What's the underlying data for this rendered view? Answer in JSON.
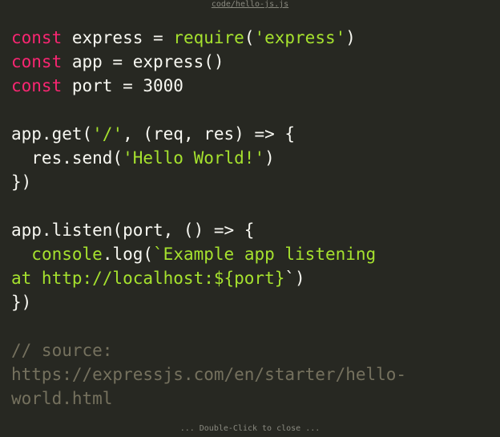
{
  "header": {
    "file_path": "code/hello-js.js"
  },
  "code": {
    "lines": [
      [
        {
          "t": "const",
          "c": "kw"
        },
        {
          "t": " express = ",
          "c": "plain"
        },
        {
          "t": "require",
          "c": "fn"
        },
        {
          "t": "(",
          "c": "plain"
        },
        {
          "t": "'express'",
          "c": "str"
        },
        {
          "t": ")",
          "c": "plain"
        }
      ],
      [
        {
          "t": "const",
          "c": "kw"
        },
        {
          "t": " app = express()",
          "c": "plain"
        }
      ],
      [
        {
          "t": "const",
          "c": "kw"
        },
        {
          "t": " port = 3000",
          "c": "plain"
        }
      ],
      [],
      [
        {
          "t": "app.get(",
          "c": "plain"
        },
        {
          "t": "'/'",
          "c": "str"
        },
        {
          "t": ", (req, res) => {",
          "c": "plain"
        }
      ],
      [
        {
          "t": "  res.send(",
          "c": "plain"
        },
        {
          "t": "'Hello World!'",
          "c": "str"
        },
        {
          "t": ")",
          "c": "plain"
        }
      ],
      [
        {
          "t": "})",
          "c": "plain"
        }
      ],
      [],
      [
        {
          "t": "app.listen(port, () => {",
          "c": "plain"
        }
      ],
      [
        {
          "t": "  ",
          "c": "plain"
        },
        {
          "t": "console",
          "c": "fn"
        },
        {
          "t": ".log(",
          "c": "plain"
        },
        {
          "t": "`Example app listening",
          "c": "str"
        }
      ],
      [
        {
          "t": "at http://localhost:${port}",
          "c": "str"
        },
        {
          "t": "`)",
          "c": "plain"
        }
      ],
      [
        {
          "t": "})",
          "c": "plain"
        }
      ],
      [],
      [
        {
          "t": "// source:",
          "c": "cmt"
        }
      ],
      [
        {
          "t": "https://expressjs.com/en/starter/hello-",
          "c": "cmt"
        }
      ],
      [
        {
          "t": "world.html",
          "c": "cmt"
        }
      ]
    ]
  },
  "footer": {
    "hint": "... Double-Click to close ..."
  },
  "colors": {
    "background": "#272822",
    "keyword": "#f92672",
    "function": "#a6e22e",
    "string": "#a6e22e",
    "comment": "#75715e",
    "text": "#f8f8f2"
  }
}
